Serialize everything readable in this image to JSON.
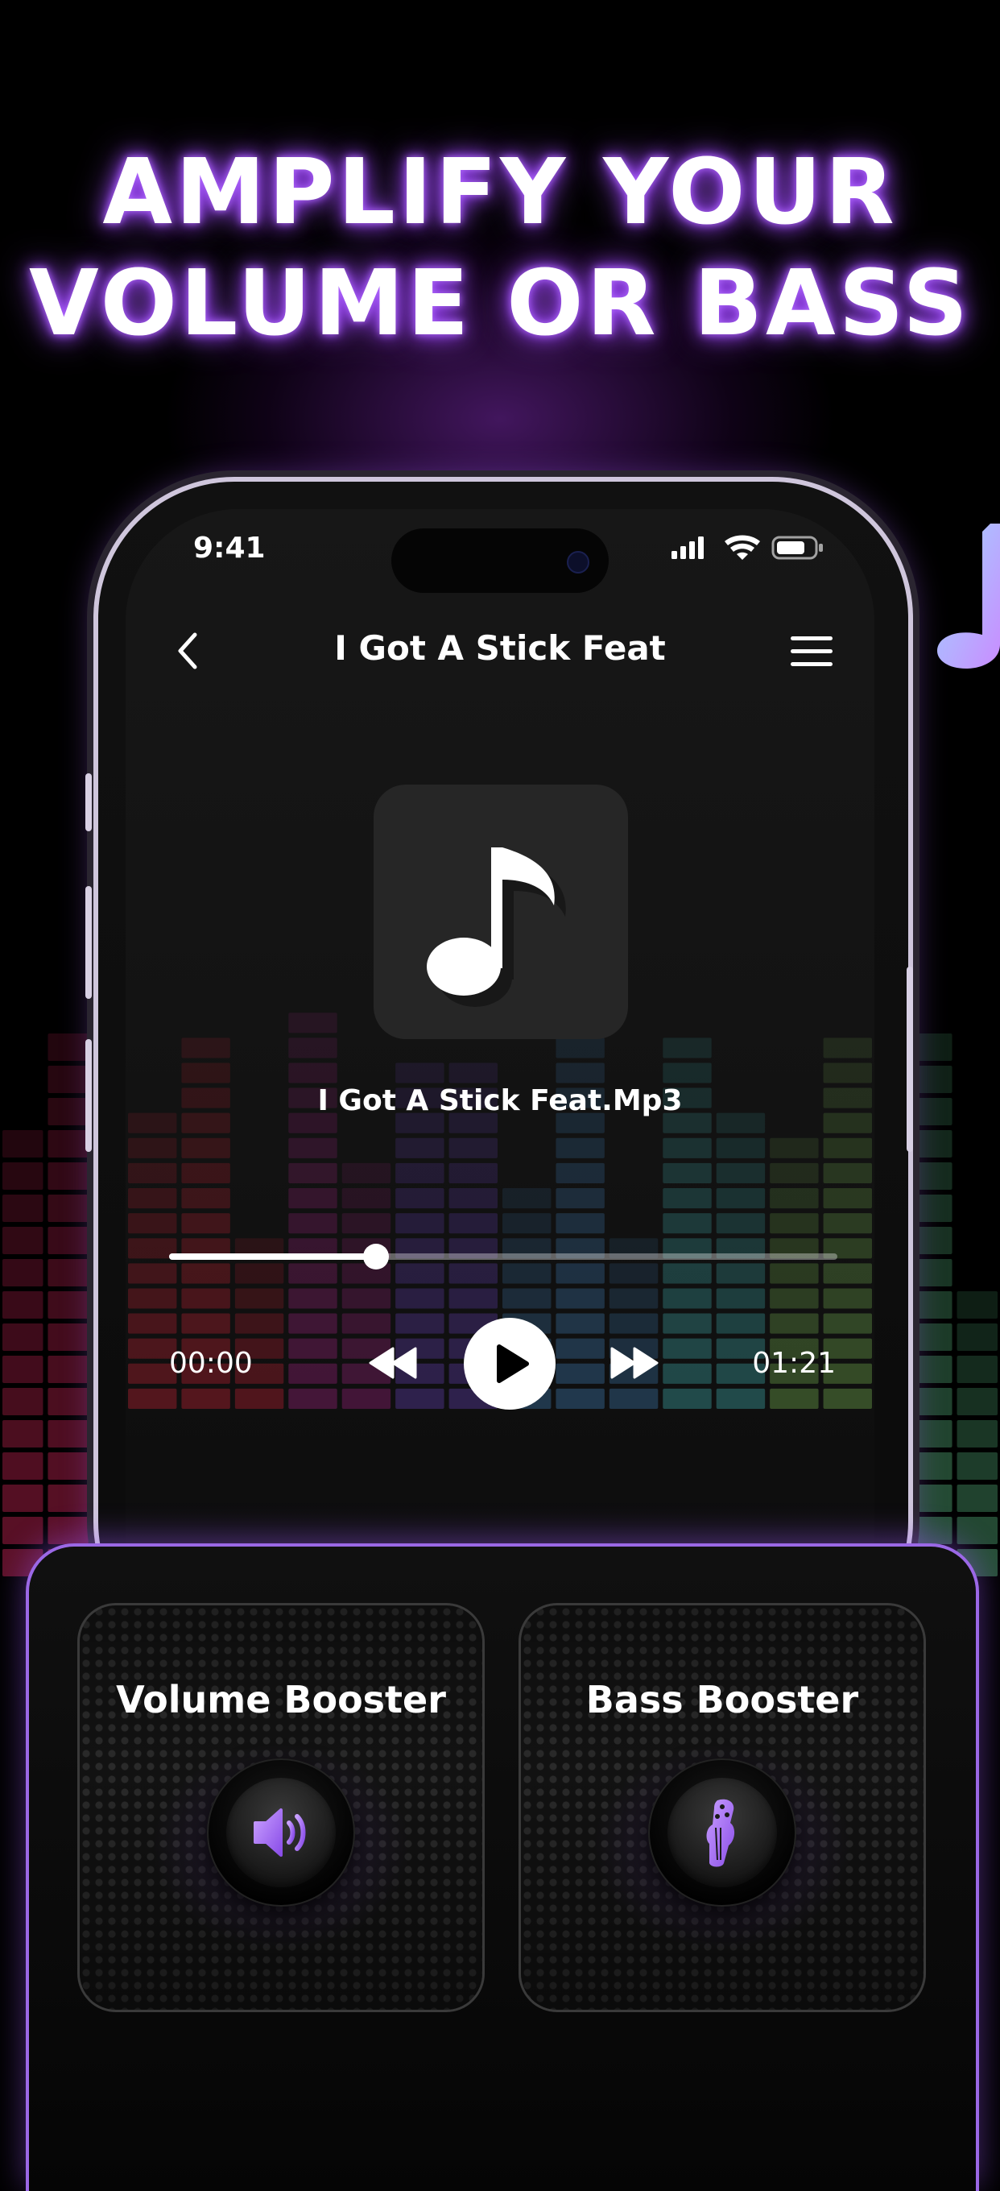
{
  "headline": {
    "line1": "AMPLIFY YOUR",
    "line2": "VOLUME OR BASS"
  },
  "status": {
    "time": "9:41",
    "icons": [
      "cellular-signal-icon",
      "wifi-icon",
      "battery-icon"
    ]
  },
  "player": {
    "title": "I Got A Stick Feat",
    "track_name": "I Got A Stick Feat.Mp3",
    "progress_fraction": 0.31,
    "time_elapsed": "00:00",
    "time_total": "01:21"
  },
  "boosters": [
    {
      "label": "Volume Booster",
      "icon": "speaker-icon"
    },
    {
      "label": "Bass Booster",
      "icon": "guitar-icon"
    }
  ],
  "colors": {
    "accent": "#9b68e6",
    "glow": "#9a3dff"
  }
}
